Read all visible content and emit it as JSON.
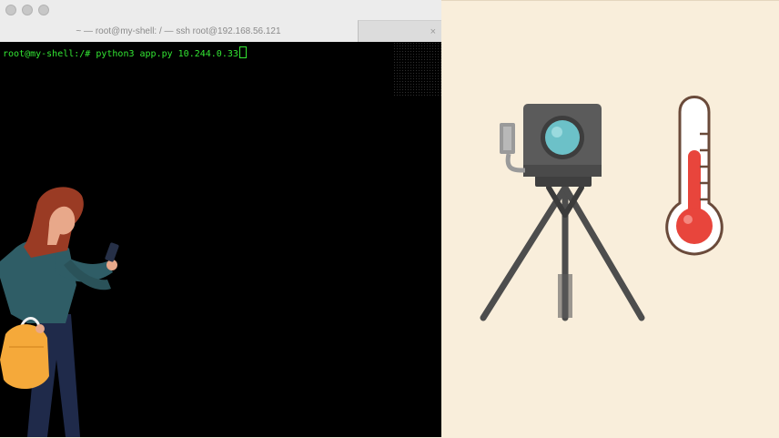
{
  "window": {
    "title": "~ — root@my-shell: / — ssh root@192.168.56.121",
    "tabs": [
      {
        "label": "~ — root@my-shell: / — ssh root@192.168.56.121",
        "active": true
      },
      {
        "label": "",
        "active": false
      }
    ]
  },
  "terminal": {
    "prompt": "root@my-shell:/#",
    "command": " python3 app.py 10.244.0.33"
  },
  "icons": {
    "traffic_lights": [
      "close-icon",
      "minimize-icon",
      "zoom-icon"
    ],
    "tab_close": "×",
    "illustrations": [
      "person-phone-illustration",
      "camera-on-tripod-icon",
      "thermometer-icon"
    ]
  },
  "colors": {
    "terminal_bg": "#000000",
    "terminal_text": "#33e633",
    "panel_bg": "#f9eedb",
    "camera_body": "#5b5b5b",
    "camera_lens": "#6cc1c8",
    "thermo_red": "#e8453c"
  }
}
